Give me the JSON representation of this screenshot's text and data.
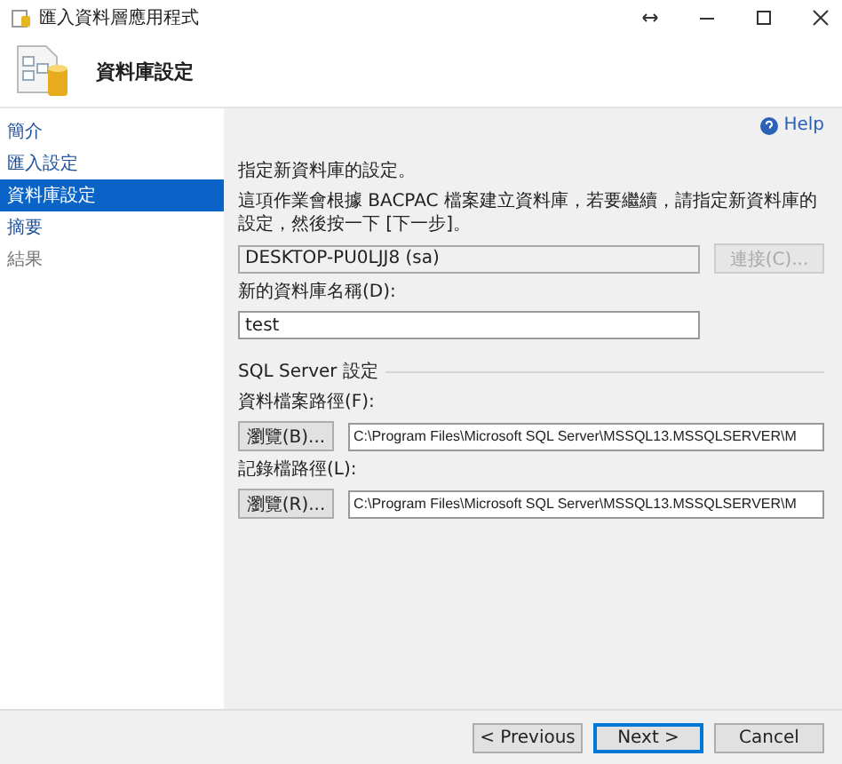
{
  "window": {
    "title": "匯入資料層應用程式"
  },
  "header": {
    "title": "資料庫設定"
  },
  "sidebar": {
    "items": [
      {
        "label": "簡介",
        "selected": false,
        "disabled": false
      },
      {
        "label": "匯入設定",
        "selected": false,
        "disabled": false
      },
      {
        "label": "資料庫設定",
        "selected": true,
        "disabled": false
      },
      {
        "label": "摘要",
        "selected": false,
        "disabled": false
      },
      {
        "label": "結果",
        "selected": false,
        "disabled": true
      }
    ]
  },
  "help": "Help",
  "intro": "指定新資料庫的設定。",
  "instructions": "這項作業會根據 BACPAC 檔案建立資料庫，若要繼續，請指定新資料庫的設定，然後按一下 [下一步]。",
  "server": {
    "value": "DESKTOP-PU0LJJ8 (sa)",
    "connect_button": {
      "label": "連接(C)...",
      "disabled": true
    }
  },
  "database_name": {
    "label": "新的資料庫名稱(D):",
    "value": "test"
  },
  "sql_server_settings": {
    "title": "SQL Server 設定",
    "paths": [
      {
        "label": "資料檔案路徑(F):",
        "browse": "瀏覽(B)...",
        "value": "C:\\Program Files\\Microsoft SQL Server\\MSSQL13.MSSQLSERVER\\M"
      },
      {
        "label": "記錄檔路徑(L):",
        "browse": "瀏覽(R)...",
        "value": "C:\\Program Files\\Microsoft SQL Server\\MSSQL13.MSSQLSERVER\\M"
      }
    ]
  },
  "buttons": [
    {
      "label": "< Previous",
      "default": false
    },
    {
      "label": "Next >",
      "default": true
    },
    {
      "label": "Cancel",
      "default": false
    }
  ]
}
